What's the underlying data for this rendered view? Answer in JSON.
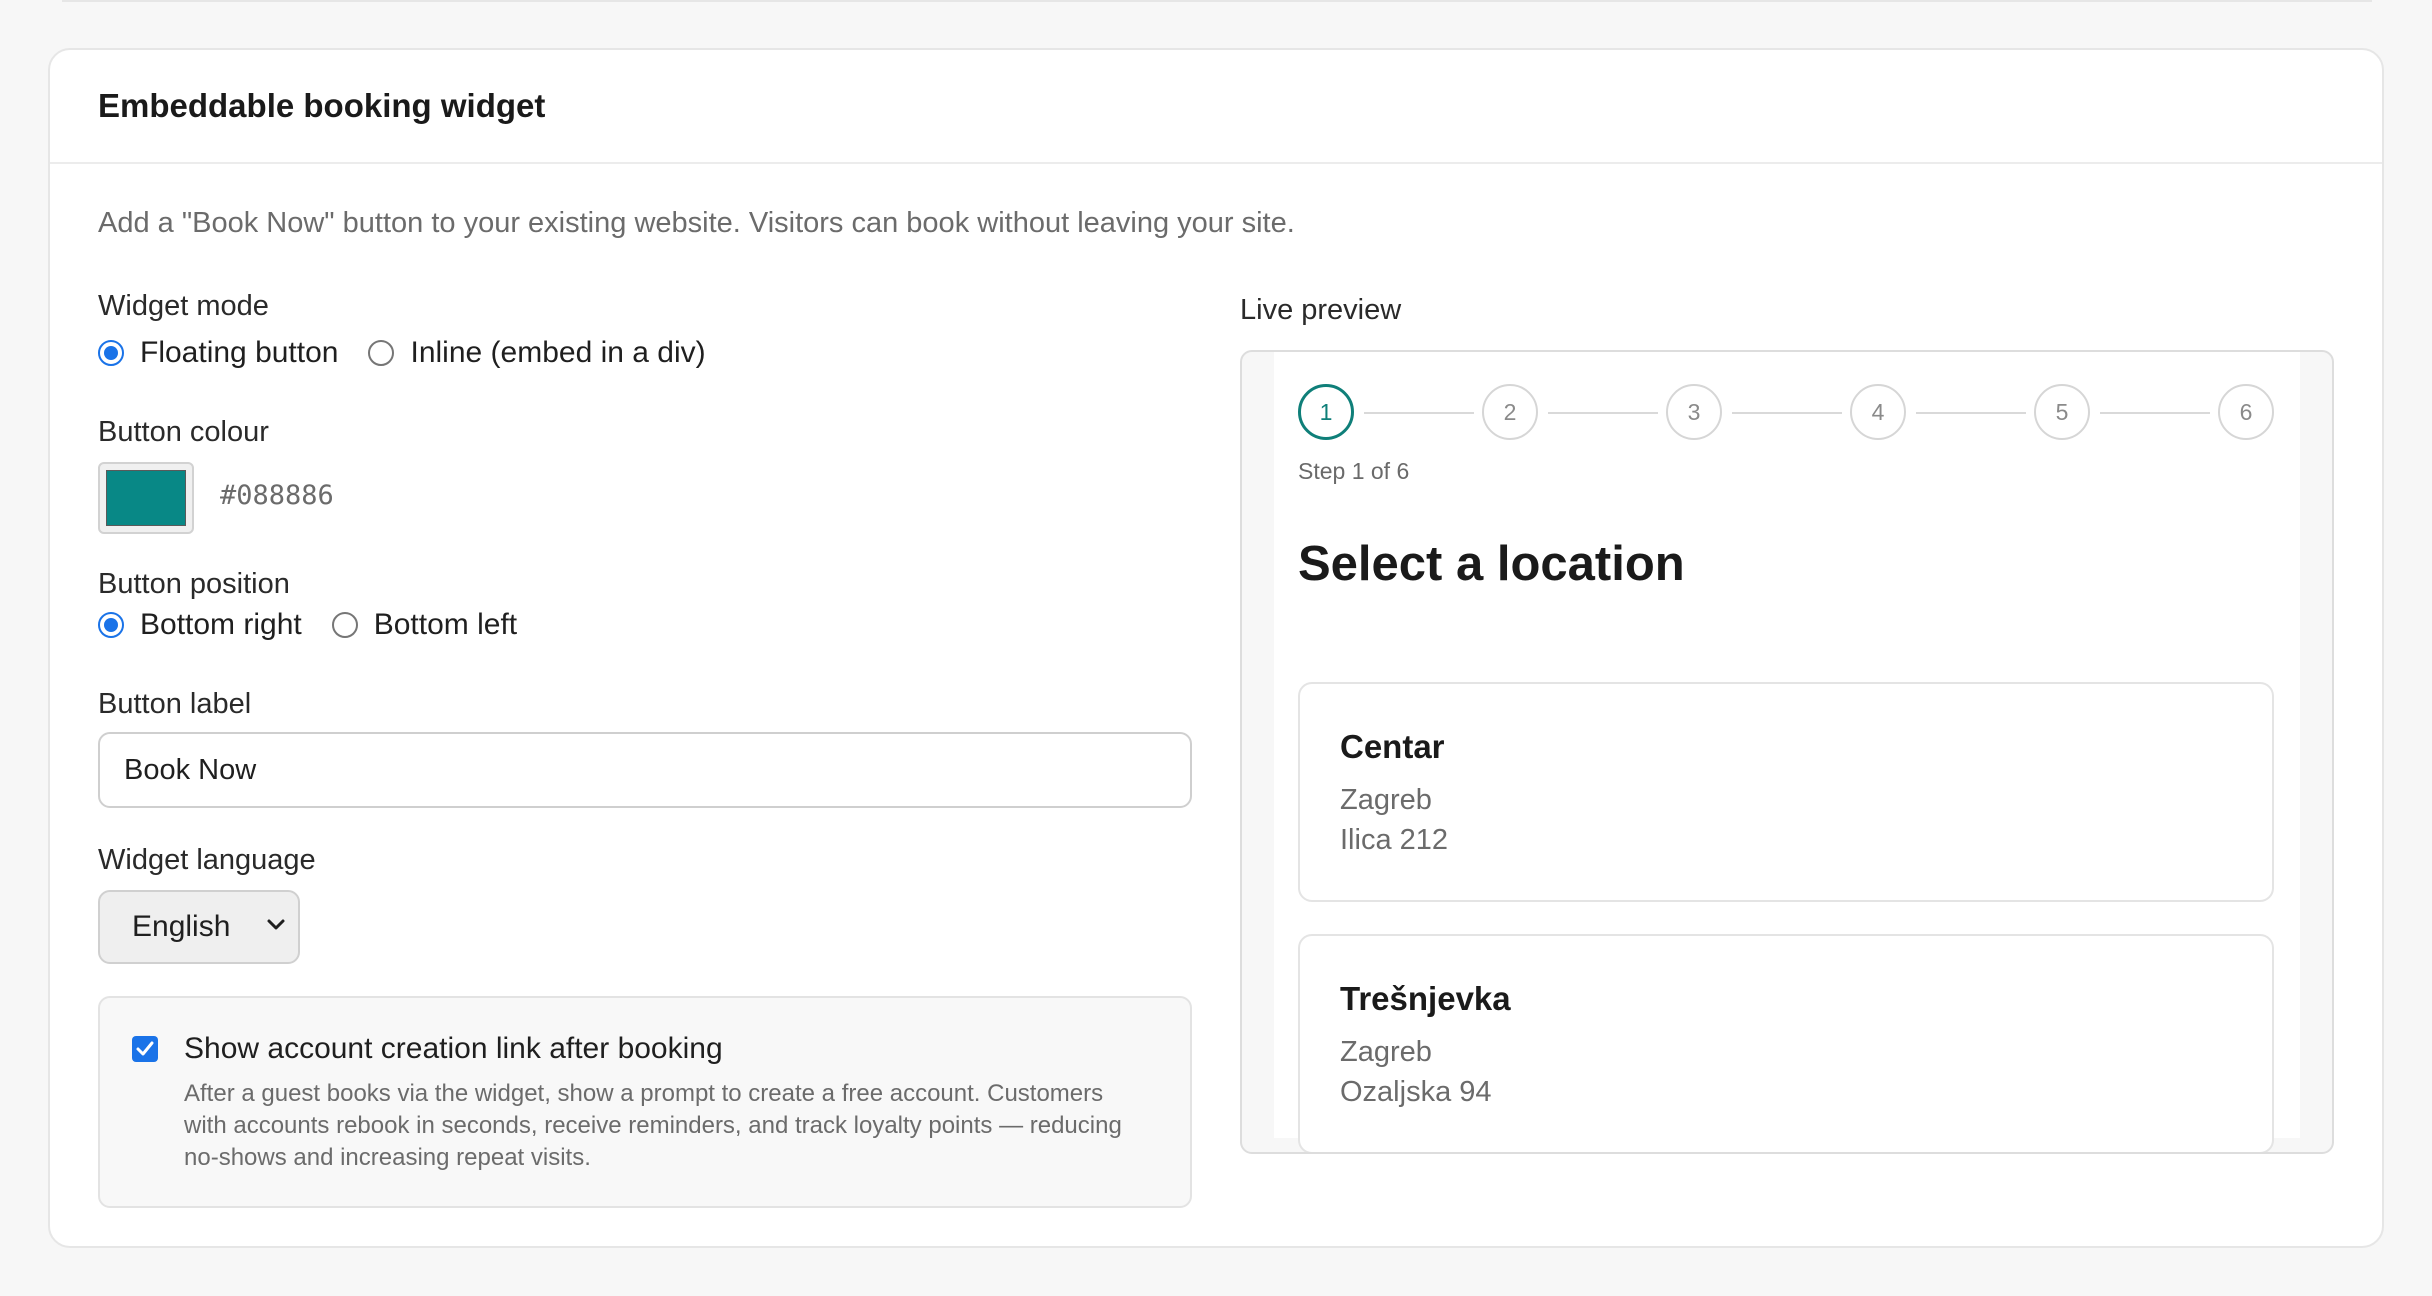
{
  "card": {
    "title": "Embeddable booking widget",
    "intro": "Add a \"Book Now\" button to your existing website. Visitors can book without leaving your site."
  },
  "widget_mode": {
    "label": "Widget mode",
    "options": [
      "Floating button",
      "Inline (embed in a div)"
    ],
    "selected": "Floating button"
  },
  "button_colour": {
    "label": "Button colour",
    "value": "#088886"
  },
  "button_position": {
    "label": "Button position",
    "options": [
      "Bottom right",
      "Bottom left"
    ],
    "selected": "Bottom right"
  },
  "button_label": {
    "label": "Button label",
    "value": "Book Now"
  },
  "widget_language": {
    "label": "Widget language",
    "selected": "English"
  },
  "account_link": {
    "checked": true,
    "title": "Show account creation link after booking",
    "description": "After a guest books via the widget, show a prompt to create a free account. Customers with accounts rebook in seconds, receive reminders, and track loyalty points — reducing no-shows and increasing repeat visits."
  },
  "preview": {
    "label": "Live preview",
    "steps": [
      "1",
      "2",
      "3",
      "4",
      "5",
      "6"
    ],
    "active_step": 1,
    "step_caption": "Step 1 of 6",
    "heading": "Select a location",
    "locations": [
      {
        "name": "Centar",
        "city": "Zagreb",
        "address": "Ilica 212"
      },
      {
        "name": "Trešnjevka",
        "city": "Zagreb",
        "address": "Ozaljska 94"
      }
    ]
  },
  "colors": {
    "accent": "#0f7f79",
    "brand_button": "#088886",
    "control_blue": "#1a73e8"
  }
}
